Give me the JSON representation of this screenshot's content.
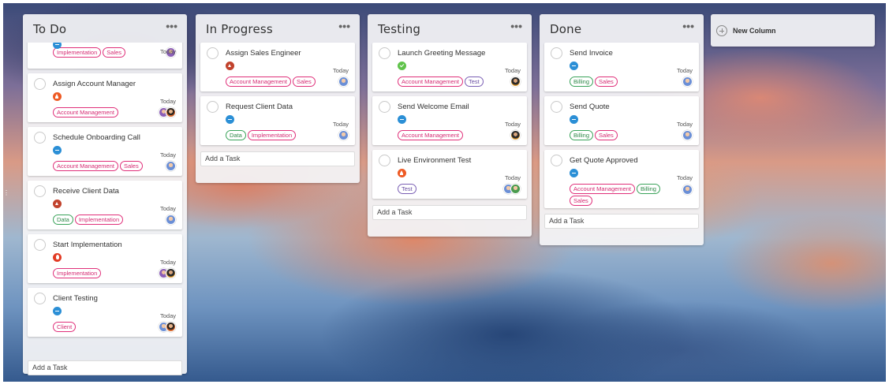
{
  "colors": {
    "priority_low": "#2b8fd6",
    "priority_done": "#5fc34a",
    "priority_up": "#c1422c",
    "priority_high": "#ee5a24",
    "tag_pink": "#d63384",
    "tag_green": "#3aa35a",
    "tag_purple": "#7a5fb4"
  },
  "columns": [
    {
      "title": "To Do",
      "menu": "•••",
      "add_task": "Add a Task",
      "cards": [
        {
          "title": "",
          "priority": "p-low",
          "date": "Today",
          "tags": [
            "Implementation",
            "Sales"
          ],
          "avatars": [
            "av-c"
          ]
        },
        {
          "title": "Assign Account Manager",
          "priority": "p-high",
          "date": "Today",
          "tags": [
            "Account Management"
          ],
          "avatars": [
            "av-c",
            "av-b"
          ]
        },
        {
          "title": "Schedule Onboarding Call",
          "priority": "p-low",
          "date": "Today",
          "tags": [
            "Account Management",
            "Sales"
          ],
          "avatars": [
            "av-a"
          ]
        },
        {
          "title": "Receive Client Data",
          "priority": "p-up",
          "date": "Today",
          "tags": [
            "Data",
            "Implementation"
          ],
          "avatars": [
            "av-a"
          ]
        },
        {
          "title": "Start Implementation",
          "priority": "p-urgent",
          "date": "Today",
          "tags": [
            "Implementation"
          ],
          "avatars": [
            "av-c",
            "av-d"
          ]
        },
        {
          "title": "Client Testing",
          "priority": "p-low",
          "date": "Today",
          "tags": [
            "Client"
          ],
          "avatars": [
            "av-a",
            "av-b"
          ]
        }
      ]
    },
    {
      "title": "In Progress",
      "menu": "•••",
      "add_task": "Add a Task",
      "cards": [
        {
          "title": "Assign Sales Engineer",
          "priority": "p-up",
          "date": "Today",
          "tags": [
            "Account Management",
            "Sales"
          ],
          "avatars": [
            "av-a"
          ]
        },
        {
          "title": "Request Client Data",
          "priority": "p-low",
          "date": "Today",
          "tags": [
            "Data",
            "Implementation"
          ],
          "avatars": [
            "av-a"
          ]
        }
      ]
    },
    {
      "title": "Testing",
      "menu": "•••",
      "add_task": "Add a Task",
      "cards": [
        {
          "title": "Launch Greeting Message",
          "priority": "p-ok",
          "date": "Today",
          "tags": [
            "Account Management",
            "Test"
          ],
          "avatars": [
            "av-d"
          ]
        },
        {
          "title": "Send Welcome Email",
          "priority": "p-low",
          "date": "Today",
          "tags": [
            "Account Management"
          ],
          "avatars": [
            "av-d"
          ]
        },
        {
          "title": "Live Environment Test",
          "priority": "p-high",
          "date": "Today",
          "tags": [
            "Test"
          ],
          "avatars": [
            "av-a",
            "av-e"
          ]
        }
      ]
    },
    {
      "title": "Done",
      "menu": "•••",
      "add_task": "Add a Task",
      "cards": [
        {
          "title": "Send Invoice",
          "priority": "p-low",
          "date": "Today",
          "tags": [
            "Billing",
            "Sales"
          ],
          "avatars": [
            "av-a"
          ]
        },
        {
          "title": "Send Quote",
          "priority": "p-low",
          "date": "Today",
          "tags": [
            "Billing",
            "Sales"
          ],
          "avatars": [
            "av-a"
          ]
        },
        {
          "title": "Get Quote Approved",
          "priority": "p-low",
          "date": "Today",
          "tags": [
            "Account Management",
            "Billing",
            "Sales"
          ],
          "avatars": [
            "av-a"
          ]
        }
      ]
    }
  ],
  "new_column": {
    "label": "New Column",
    "icon": "plus-circle-icon"
  }
}
